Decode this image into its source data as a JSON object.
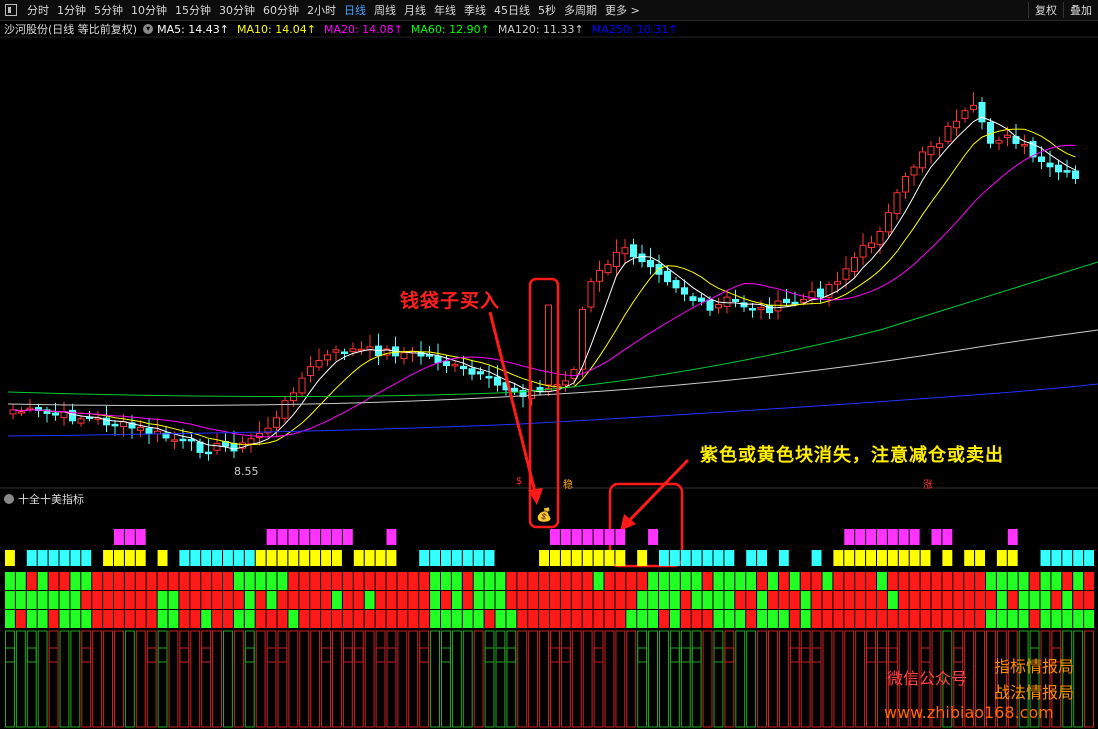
{
  "toolbar": {
    "periods": [
      "分时",
      "1分钟",
      "5分钟",
      "10分钟",
      "15分钟",
      "30分钟",
      "60分钟",
      "2小时",
      "日线",
      "周线",
      "月线",
      "年线",
      "季线",
      "45日线",
      "5秒",
      "多周期",
      "更多 >"
    ],
    "active": "日线",
    "right": [
      "复权",
      "叠加"
    ]
  },
  "info": {
    "stock": "沙河股份(日线 等比前复权)",
    "ma": [
      {
        "label": "MA5: 14.43↑",
        "color": "#ffffff"
      },
      {
        "label": "MA10: 14.04↑",
        "color": "#ffff00"
      },
      {
        "label": "MA20: 14.08↑",
        "color": "#ff00ff"
      },
      {
        "label": "MA60: 12.90↑",
        "color": "#00ff00"
      },
      {
        "label": "MA120: 11.33↑",
        "color": "#cccccc"
      },
      {
        "label": "MA250: 10.31↑",
        "color": "#0000ff"
      }
    ]
  },
  "chart_data": {
    "type": "candlestick",
    "low_label": "8.55",
    "tags": {
      "small_left": "$",
      "small_mid": "稳",
      "small_right": "涨",
      "money_bag": "💰"
    }
  },
  "indicator": {
    "title": "十全十美指标"
  },
  "annotations": {
    "buy": "钱袋子买入",
    "warn": "紫色或黄色块消失，注意减仓或卖出"
  },
  "watermark": {
    "wx": "微信公众号",
    "l1": "指标情报局",
    "l2": "战法情报局",
    "url": "www.zhibiao168.com"
  }
}
